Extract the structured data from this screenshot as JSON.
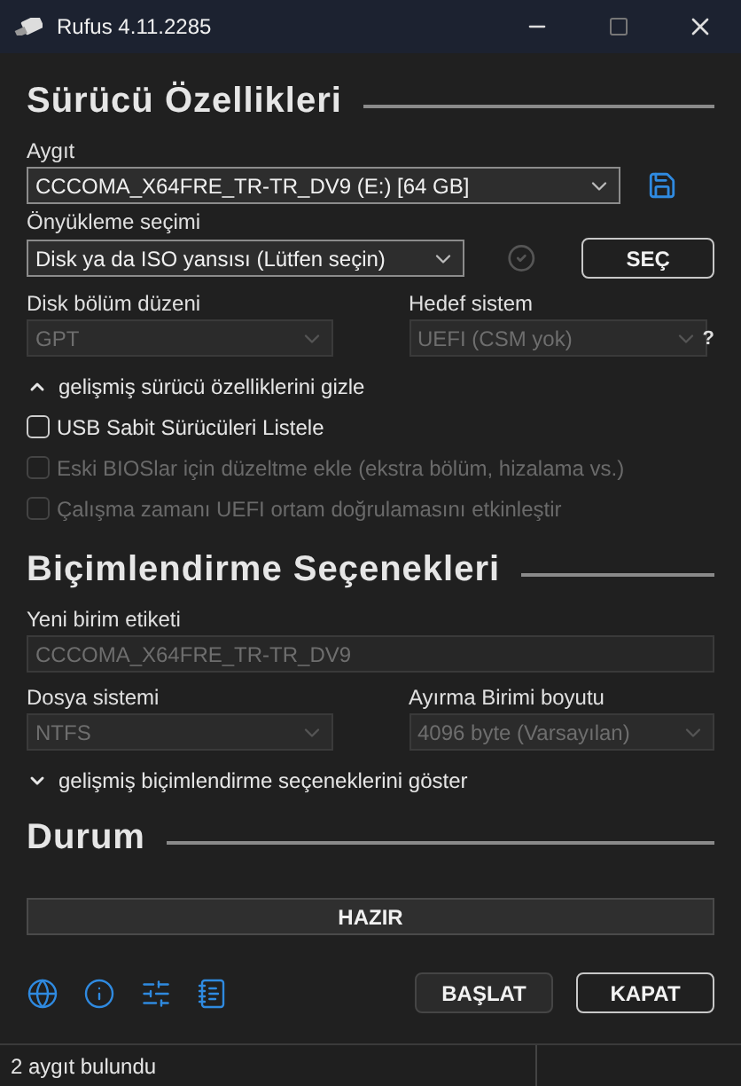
{
  "window": {
    "title": "Rufus 4.11.2285"
  },
  "drive_properties": {
    "heading": "Sürücü Özellikleri",
    "device": {
      "label": "Aygıt",
      "value": "CCCOMA_X64FRE_TR-TR_DV9 (E:) [64 GB]",
      "disabled": false
    },
    "boot_selection": {
      "label": "Önyükleme seçimi",
      "value": "Disk ya da ISO yansısı (Lütfen seçin)",
      "disabled": false,
      "select_button": "SEÇ"
    },
    "partition_scheme": {
      "label": "Disk bölüm düzeni",
      "value": "GPT",
      "disabled": true
    },
    "target_system": {
      "label": "Hedef sistem",
      "value": "UEFI (CSM yok)",
      "disabled": true,
      "help": "?"
    },
    "advanced_toggle": {
      "label": "gelişmiş sürücü özelliklerini gizle",
      "expanded": true
    },
    "options": [
      {
        "label": "USB Sabit Sürücüleri Listele",
        "checked": false,
        "disabled": false
      },
      {
        "label": "Eski BIOSlar için düzeltme ekle (ekstra bölüm, hizalama vs.)",
        "checked": false,
        "disabled": true
      },
      {
        "label": "Çalışma zamanı UEFI ortam doğrulamasını etkinleştir",
        "checked": false,
        "disabled": true
      }
    ]
  },
  "format_options": {
    "heading": "Biçimlendirme Seçenekleri",
    "volume_label": {
      "label": "Yeni birim etiketi",
      "value": "CCCOMA_X64FRE_TR-TR_DV9",
      "disabled": true
    },
    "file_system": {
      "label": "Dosya sistemi",
      "value": "NTFS",
      "disabled": true
    },
    "cluster_size": {
      "label": "Ayırma Birimi boyutu",
      "value": "4096 byte (Varsayılan)",
      "disabled": true
    },
    "advanced_toggle": {
      "label": "gelişmiş biçimlendirme seçeneklerini göster",
      "expanded": false
    }
  },
  "status": {
    "heading": "Durum",
    "progress": {
      "text": "HAZIR",
      "level": 0
    }
  },
  "buttons": [
    {
      "label": "BAŞLAT",
      "focused": false
    },
    {
      "label": "KAPAT",
      "focused": true
    }
  ],
  "status_bar": {
    "text": "2 aygıt bulundu"
  }
}
